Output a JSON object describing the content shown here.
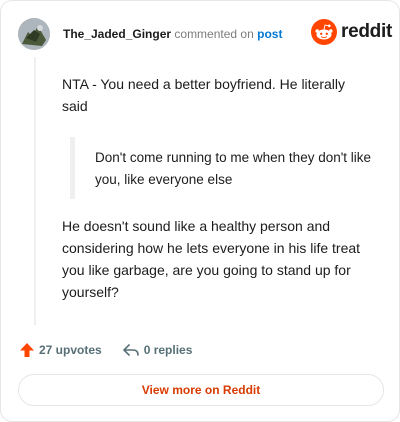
{
  "header": {
    "username": "The_Jaded_Ginger",
    "commented_text": "commented on",
    "post_link": "post",
    "brand": "reddit"
  },
  "comment": {
    "paragraph1": "NTA - You need a better boyfriend. He literally said",
    "quote": "Don't come running to me when they don't like you, like everyone else",
    "paragraph2": "He doesn't sound like a healthy person and considering how he lets everyone in his life treat you like garbage, are you going to stand up for yourself?"
  },
  "actions": {
    "upvotes": "27 upvotes",
    "replies": "0 replies"
  },
  "footer": {
    "view_more": "View more on Reddit"
  },
  "colors": {
    "brand_orange": "#ff4500",
    "link_blue": "#0079d3",
    "view_more_text": "#d93a00",
    "muted": "#576f76"
  }
}
